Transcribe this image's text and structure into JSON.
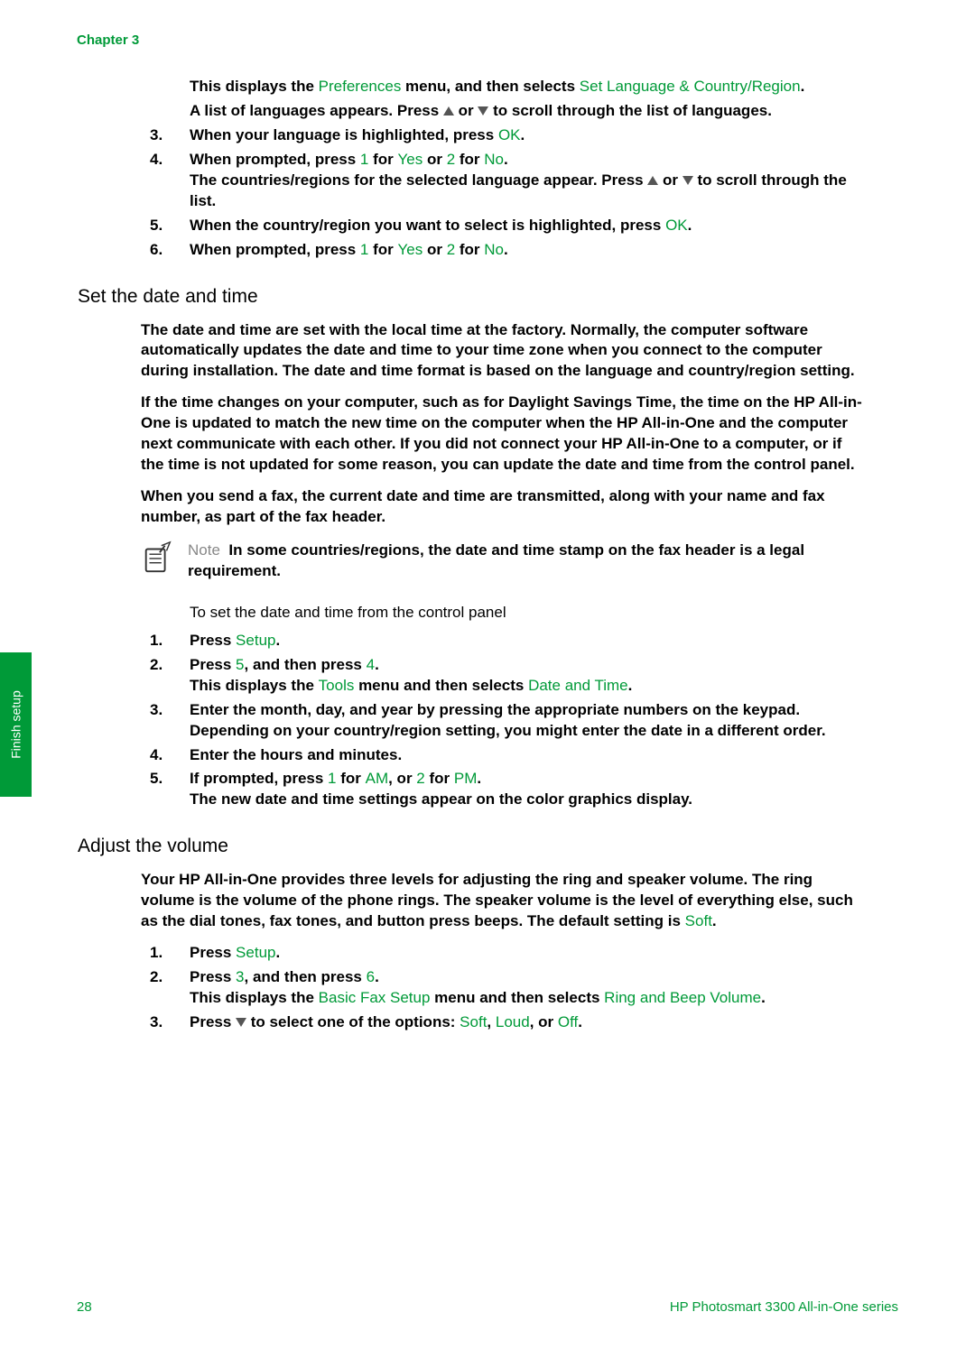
{
  "chapter": "Chapter 3",
  "intro": {
    "line1a": "This displays the ",
    "pref": "Preferences",
    "line1b": " menu, and then selects ",
    "setlang": "Set Language & Country/Region",
    "dot": ".",
    "line2a": "A list of languages appears. Press ",
    "line2b": " or ",
    "line2c": " to scroll through the list of languages."
  },
  "listA": {
    "3": {
      "a": "When your language is highlighted, press ",
      "ok": "OK",
      "dot": "."
    },
    "4": {
      "a": "When prompted, press ",
      "one": "1",
      "b": " for ",
      "yes": "Yes",
      "c": " or ",
      "two": "2",
      "d": " for ",
      "no": "No",
      "dot": ".",
      "sub_a": "The countries/regions for the selected language appear. Press ",
      "sub_b": " or ",
      "sub_c": " to scroll through the list."
    },
    "5": {
      "a": "When the country/region you want to select is highlighted, press ",
      "ok": "OK",
      "dot": "."
    },
    "6": {
      "a": "When prompted, press ",
      "one": "1",
      "b": " for ",
      "yes": "Yes",
      "c": " or ",
      "two": "2",
      "d": " for ",
      "no": "No",
      "dot": "."
    }
  },
  "h_date": "Set the date and time",
  "date_p1": "The date and time are set with the local time at the factory. Normally, the computer software automatically updates the date and time to your time zone when you connect to the computer during installation. The date and time format is based on the language and country/region setting.",
  "date_p2": "If the time changes on your computer, such as for Daylight Savings Time, the time on the HP All-in-One is updated to match the new time on the computer when the HP All-in-One and the computer next communicate with each other. If you did not connect your HP All-in-One to a computer, or if the time is not updated for some reason, you can update the date and time from the control panel.",
  "date_p3": "When you send a fax, the current date and time are transmitted, along with your name and fax number, as part of the fax header.",
  "note": {
    "label": "Note",
    "body": "In some countries/regions, the date and time stamp on the fax header is a legal requirement."
  },
  "sub_date": "To set the date and time from the control panel",
  "listB": {
    "1": {
      "a": "Press ",
      "setup": "Setup",
      "dot": "."
    },
    "2": {
      "a": "Press ",
      "five": "5",
      "b": ", and then press ",
      "four": "4",
      "dot": ".",
      "sub_a": "This displays the ",
      "tools": "Tools",
      "sub_b": " menu and then selects ",
      "dt": "Date and Time",
      "sub_dot": "."
    },
    "3": {
      "a": "Enter the month, day, and year by pressing the appropriate numbers on the keypad. Depending on your country/region setting, you might enter the date in a different order."
    },
    "4": {
      "a": "Enter the hours and minutes."
    },
    "5": {
      "a": "If prompted, press ",
      "one": "1",
      "b": " for ",
      "am": "AM",
      "c": ", or ",
      "two": "2",
      "d": " for ",
      "pm": "PM",
      "dot": ".",
      "sub": "The new date and time settings appear on the color graphics display."
    }
  },
  "h_vol": "Adjust the volume",
  "vol_p1a": "Your HP All-in-One provides three levels for adjusting the ring and speaker volume. The ring volume is the volume of the phone rings. The speaker volume is the level of everything else, such as the dial tones, fax tones, and button press beeps. The default setting is ",
  "vol_soft": "Soft",
  "vol_p1b": ".",
  "listC": {
    "1": {
      "a": "Press ",
      "setup": "Setup",
      "dot": "."
    },
    "2": {
      "a": "Press ",
      "three": "3",
      "b": ", and then press ",
      "six": "6",
      "dot": ".",
      "sub_a": "This displays the ",
      "bfs": "Basic Fax Setup",
      "sub_b": " menu and then selects ",
      "rbv": "Ring and Beep Volume",
      "sub_dot": "."
    },
    "3": {
      "a": "Press ",
      "b": " to select one of the options: ",
      "soft": "Soft",
      "c": ", ",
      "loud": "Loud",
      "d": ", or ",
      "off": "Off",
      "dot": "."
    }
  },
  "sidetab": "Finish setup",
  "footer": {
    "page": "28",
    "title": "HP Photosmart 3300 All-in-One series"
  }
}
